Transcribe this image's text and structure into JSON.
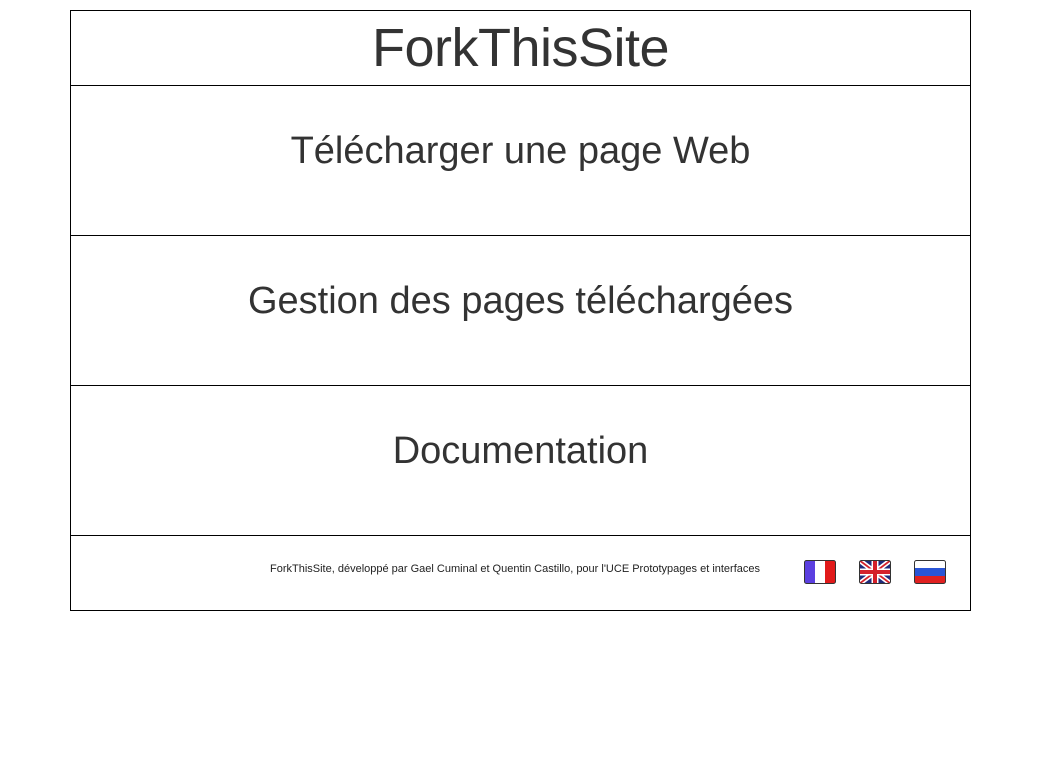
{
  "header": {
    "title": "ForkThisSite"
  },
  "menu": {
    "items": [
      {
        "label": "Télécharger une page Web"
      },
      {
        "label": "Gestion des pages téléchargées"
      },
      {
        "label": "Documentation"
      }
    ]
  },
  "footer": {
    "credit": "ForkThisSite, développé par Gael Cuminal et Quentin Castillo, pour l'UCE Prototypages et interfaces",
    "languages": [
      {
        "icon": "flag-fr-icon"
      },
      {
        "icon": "flag-uk-icon"
      },
      {
        "icon": "flag-ru-icon"
      }
    ]
  },
  "colors": {
    "text": "#333333",
    "border": "#000000",
    "background": "#ffffff"
  }
}
